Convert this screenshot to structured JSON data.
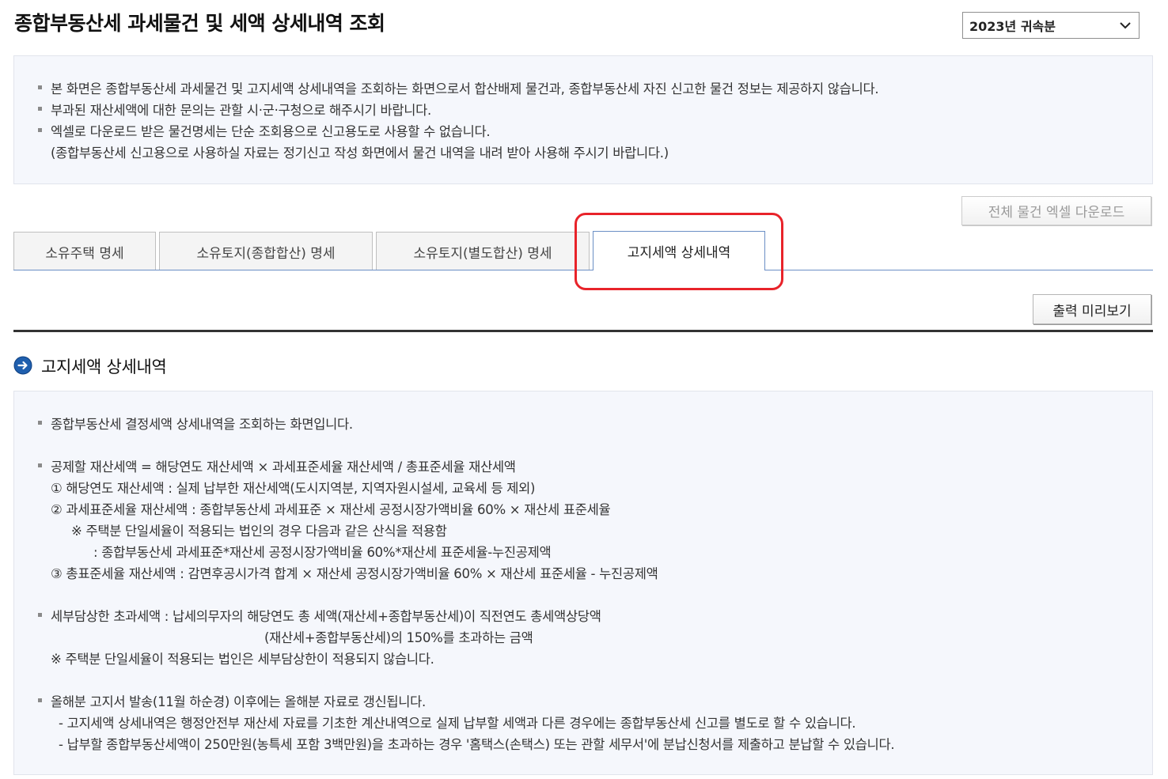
{
  "header": {
    "title": "종합부동산세 과세물건 및 세액 상세내역 조회",
    "year_select": "2023년 귀속분"
  },
  "notice": {
    "lines": [
      "본 화면은 종합부동산세 과세물건 및 고지세액 상세내역을 조회하는 화면으로서 합산배제 물건과, 종합부동산세 자진 신고한 물건 정보는 제공하지 않습니다.",
      "부과된 재산세액에 대한 문의는 관할 시·군·구청으로 해주시기 바랍니다.",
      "엑셀로 다운로드 받은 물건명세는 단순 조회용으로 신고용도로 사용할 수 없습니다.",
      "(종합부동산세 신고용으로 사용하실 자료는 정기신고 작성 화면에서 물건 내역을 내려 받아 사용해 주시기 바랍니다.)"
    ]
  },
  "buttons": {
    "excel_download": "전체 물건 엑셀 다운로드",
    "print_preview": "출력 미리보기"
  },
  "tabs": [
    {
      "label": "소유주택 명세"
    },
    {
      "label": "소유토지(종합합산) 명세"
    },
    {
      "label": "소유토지(별도합산) 명세"
    },
    {
      "label": "고지세액 상세내역"
    }
  ],
  "section": {
    "title": "고지세액 상세내역",
    "lines": [
      "종합부동산세 결정세액 상세내역을 조회하는 화면입니다.",
      "공제할 재산세액 = 해당연도 재산세액 × 과세표준세율 재산세액 / 총표준세율 재산세액",
      "① 해당연도 재산세액 : 실제 납부한 재산세액(도시지역분, 지역자원시설세, 교육세 등 제외)",
      "② 과세표준세율 재산세액 : 종합부동산세 과세표준 × 재산세 공정시장가액비율 60% × 재산세 표준세율",
      "※ 주택분 단일세율이 적용되는 법인의 경우 다음과 같은 산식을 적용함",
      ": 종합부동산세 과세표준*재산세 공정시장가액비율 60%*재산세 표준세율-누진공제액",
      "③ 총표준세율 재산세액 : 감면후공시가격 합계 × 재산세 공정시장가액비율 60% × 재산세 표준세율 - 누진공제액",
      "세부담상한 초과세액 : 납세의무자의 해당연도 총 세액(재산세+종합부동산세)이 직전연도 총세액상당액",
      "(재산세+종합부동산세)의 150%를 초과하는 금액",
      "※ 주택분 단일세율이 적용되는 법인은 세부담상한이 적용되지 않습니다.",
      "올해분 고지서 발송(11월 하순경) 이후에는 올해분 자료로 갱신됩니다.",
      "- 고지세액 상세내역은 행정안전부 재산세 자료를 기초한 계산내역으로 실제 납부할 세액과 다른 경우에는 종합부동산세 신고를 별도로 할 수 있습니다.",
      "- 납부할 종합부동산세액이 250만원(농특세 포함 3백만원)을 초과하는 경우 '홈택스(손택스) 또는 관할 세무서'에 분납신청서를 제출하고 분납할 수 있습니다."
    ]
  },
  "colors": {
    "highlight": "#e8232a",
    "tab_active_border": "#6b8fc5",
    "info_bg": "#f5f7fc"
  }
}
